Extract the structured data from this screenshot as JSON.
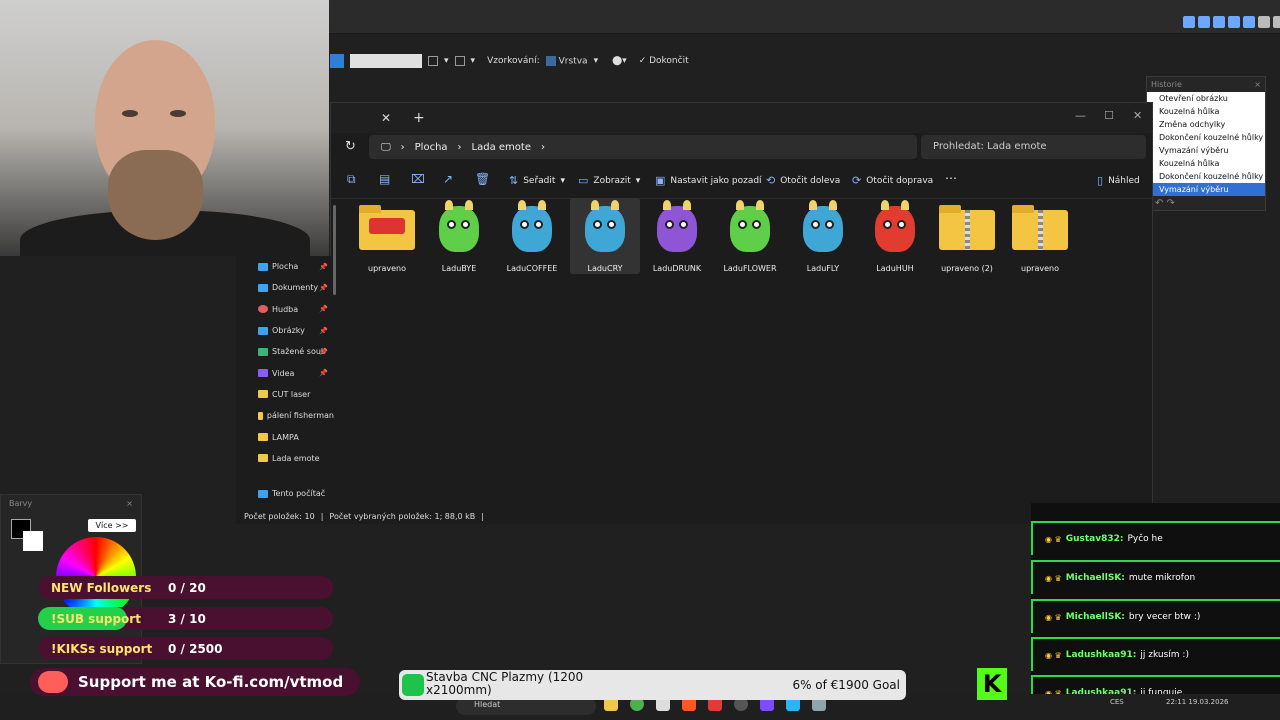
{
  "paint": {
    "vzorkovani_label": "Vzorkování:",
    "vrstva_label": "Vrstva",
    "dokoncit_label": "Dokončit"
  },
  "history": {
    "title": "Historie",
    "items": [
      "Otevření obrázku",
      "Kouzelná hůlka",
      "Změna odchylky",
      "Dokončení kouzelné hůlky",
      "Vymazání výběru",
      "Kouzelná hůlka",
      "Dokončení kouzelné hůlky",
      "Vymazání výběru"
    ],
    "selected_index": 7
  },
  "explorer": {
    "path": [
      "Plocha",
      "Lada emote"
    ],
    "search_placeholder": "Prohledat: Lada emote",
    "commands": {
      "seradit": "Seřadit",
      "zobrazit": "Zobrazit",
      "nastavit": "Nastavit jako pozadí",
      "otocit_doleva": "Otočit doleva",
      "otocit_doprava": "Otočit doprava",
      "nahled": "Náhled"
    },
    "sidebar": [
      {
        "label": "Plocha",
        "icon": "desktop-icon",
        "pinned": true
      },
      {
        "label": "Dokumenty",
        "icon": "documents-icon",
        "pinned": true
      },
      {
        "label": "Hudba",
        "icon": "music-icon",
        "pinned": true
      },
      {
        "label": "Obrázky",
        "icon": "pictures-icon",
        "pinned": true
      },
      {
        "label": "Stažené soub",
        "icon": "download-icon",
        "pinned": true
      },
      {
        "label": "Videa",
        "icon": "videos-icon",
        "pinned": true
      },
      {
        "label": "CUT laser",
        "icon": "folder-icon",
        "pinned": false
      },
      {
        "label": "pálení fisherman",
        "icon": "folder-icon",
        "pinned": false
      },
      {
        "label": "LAMPA",
        "icon": "folder-icon",
        "pinned": false
      },
      {
        "label": "Lada emote",
        "icon": "folder-icon",
        "pinned": false
      },
      {
        "label": "Tento počítač",
        "icon": "computer-icon",
        "pinned": false
      }
    ],
    "files": [
      {
        "name": "upraveno",
        "kind": "folder"
      },
      {
        "name": "LaduBYE",
        "kind": "image",
        "color": "#5fcf4a"
      },
      {
        "name": "LaduCOFFEE",
        "kind": "image",
        "color": "#3fa7d6"
      },
      {
        "name": "LaduCRY",
        "kind": "image",
        "color": "#3fa7d6"
      },
      {
        "name": "LaduDRUNK",
        "kind": "image",
        "color": "#8e55d6"
      },
      {
        "name": "LaduFLOWER",
        "kind": "image",
        "color": "#5fcf4a"
      },
      {
        "name": "LaduFLY",
        "kind": "image",
        "color": "#3fa7d6"
      },
      {
        "name": "LaduHUH",
        "kind": "image",
        "color": "#e23b2f"
      },
      {
        "name": "upraveno (2)",
        "kind": "zip"
      },
      {
        "name": "upraveno",
        "kind": "zip"
      }
    ],
    "selected_file": 3,
    "status": {
      "count": "Počet položek: 10",
      "selected": "Počet vybraných položek: 1; 88,0 kB"
    }
  },
  "colors_panel": {
    "title": "Barvy",
    "more": "Více >>"
  },
  "goals": [
    {
      "label": "NEW Followers",
      "value": "0 / 20",
      "progress": 0.0
    },
    {
      "label": "!SUB support",
      "value": "3 / 10",
      "progress": 0.3
    },
    {
      "label": "!KIKSs support",
      "value": "0 / 2500",
      "progress": 0.0
    }
  ],
  "chat": [
    {
      "nick": "Gustav832:",
      "text": "Pyčo he"
    },
    {
      "nick": "MichaellSK:",
      "text": "mute mikrofon"
    },
    {
      "nick": "MichaellSK:",
      "text": "bry vecer btw :)"
    },
    {
      "nick": "Ladushkaa91:",
      "text": "jj zkusím :)"
    },
    {
      "nick": "Ladushkaa91:",
      "text": "jj funguje."
    }
  ],
  "kofi": {
    "text": "Support me at Ko-fi.com/vtmod"
  },
  "cnc": {
    "title": "Stavba CNC Plazmy (1200 x2100mm)",
    "goal": "6% of €1900 Goal"
  },
  "taskbar": {
    "search": "Hledat",
    "lang": "CES",
    "time": "22:11",
    "date": "19.03.2026"
  },
  "kick_logo": "K"
}
